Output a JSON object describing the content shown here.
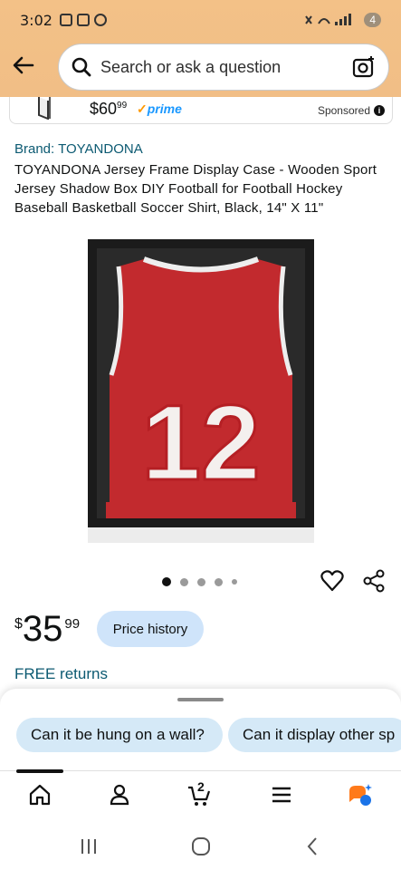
{
  "status": {
    "time": "3:02",
    "battery": "4"
  },
  "search": {
    "placeholder": "Search or ask a question"
  },
  "sponsored": {
    "price_whole": "$60",
    "price_frac": "99",
    "prime": "prime",
    "label": "Sponsored"
  },
  "product": {
    "brand": "Brand: TOYANDONA",
    "title": "TOYANDONA Jersey Frame Display Case - Wooden Sport Jersey Shadow Box DIY Football for Football Hockey Baseball Basketball Soccer Shirt, Black, 14\" X 11\"",
    "jersey_number": "12",
    "price_currency": "$",
    "price_whole": "35",
    "price_frac": "99",
    "price_history_label": "Price history",
    "free_returns": "FREE returns"
  },
  "chips": [
    "Can it be hung on a wall?",
    "Can it display other sp"
  ],
  "nav": {
    "cart_count": "2"
  },
  "colors": {
    "header": "#f1be86",
    "link": "#0c5a72",
    "chip": "#d5e9f7",
    "prime": "#1a98ff"
  }
}
